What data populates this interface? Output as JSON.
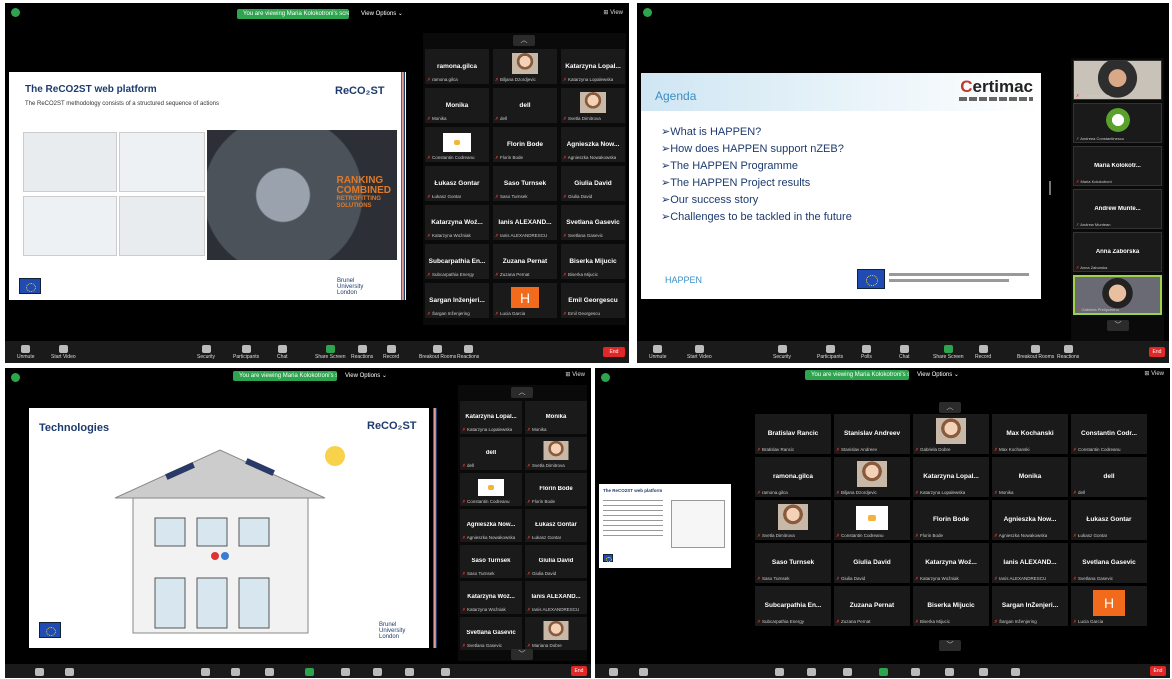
{
  "q1": {
    "banner": "You are viewing Maria Kolokotroni's screen",
    "view_options": "View Options ⌄",
    "view_corner": "⊞ View",
    "slide_title": "The ReCO2ST web platform",
    "slide_subtitle": "The ReCO2ST methodology consists of a structured sequence of actions",
    "slide_logo": "ReCO₂ST",
    "ranking": [
      "RANKING",
      "COMBINED",
      "RETROFITTING",
      "SOLUTIONS"
    ],
    "brunel": [
      "Brunel",
      "University",
      "London"
    ],
    "gallery": [
      {
        "name": "ramona.gilca",
        "label": "ramona.gilca",
        "type": "name"
      },
      {
        "name": "",
        "label": "Biljana Dzordjevic",
        "type": "pic"
      },
      {
        "name": "Katarzyna Lopal...",
        "label": "Katarzyna Lopalewska",
        "type": "name"
      },
      {
        "name": "Monika",
        "label": "Monika",
        "type": "name"
      },
      {
        "name": "dell",
        "label": "dell",
        "type": "name"
      },
      {
        "name": "",
        "label": "Svetla Dimitrova",
        "type": "pic"
      },
      {
        "name": "",
        "label": "Constantin Codreanu",
        "type": "wpic"
      },
      {
        "name": "Florin Bode",
        "label": "Florin Bode",
        "type": "name"
      },
      {
        "name": "Agnieszka Now...",
        "label": "Agnieszka Nowakowska",
        "type": "name"
      },
      {
        "name": "Łukasz Gontar",
        "label": "Łukasz Gontar",
        "type": "name"
      },
      {
        "name": "Saso Turnsek",
        "label": "Saso Turnsek",
        "type": "name"
      },
      {
        "name": "Giulia David",
        "label": "Giulia David",
        "type": "name"
      },
      {
        "name": "Katarzyna Woź...",
        "label": "Katarzyna Woźniak",
        "type": "name"
      },
      {
        "name": "Ianis ALEXAND...",
        "label": "Ianis ALEXANDRESCU",
        "type": "name"
      },
      {
        "name": "Svetlana Gasevic",
        "label": "Svetlana Gasevic",
        "type": "name"
      },
      {
        "name": "Subcarpathia En...",
        "label": "Subcarpathia Energy",
        "type": "name"
      },
      {
        "name": "Zuzana Pernat",
        "label": "Zuzana Pernat",
        "type": "name"
      },
      {
        "name": "Biserka Mijucic",
        "label": "Biserka Mijucic",
        "type": "name"
      },
      {
        "name": "Šargan Inženjeri...",
        "label": "Šargan Inženjering",
        "type": "name"
      },
      {
        "name": "H",
        "label": "Lucia Garcia",
        "type": "H"
      },
      {
        "name": "Emil Georgescu",
        "label": "Emil Georgescu",
        "type": "name"
      }
    ],
    "toolbar": [
      "Unmute",
      "Start Video",
      "Security",
      "Participants",
      "Chat",
      "Share Screen",
      "Reactions",
      "Record",
      "Breakout Rooms",
      "Reactions"
    ],
    "end": "End"
  },
  "q2": {
    "agenda_title": "Agenda",
    "brand": "ertimac",
    "brand_initial": "C",
    "bullets": [
      "➢What is HAPPEN?",
      "➢How does HAPPEN support nZEB?",
      "➢The HAPPEN Programme",
      "➢The HAPPEN Project results",
      "➢Our success story",
      "➢Challenges to be tackled in the future"
    ],
    "happen_logo": "HAPPEN",
    "side": [
      {
        "name": "",
        "label": "Dr. Ioannis Valta",
        "type": "cam"
      },
      {
        "name": "",
        "label": "Andreea Constantinescu",
        "type": "logo"
      },
      {
        "name": "Maria Kolokotr...",
        "label": "Maria Kolokotroni",
        "type": "name"
      },
      {
        "name": "Andrew Munte...",
        "label": "Andrew Muntean",
        "type": "name"
      },
      {
        "name": "Anna Zaborska",
        "label": "Anna Zaborska",
        "type": "name"
      },
      {
        "name": "",
        "label": "Gabriela Prelipceanu",
        "type": "cam2"
      }
    ],
    "toolbar": [
      "Unmute",
      "Start Video",
      "Security",
      "Participants",
      "Polls",
      "Chat",
      "Share Screen",
      "Record",
      "Breakout Rooms",
      "Reactions"
    ],
    "end": "End"
  },
  "q3": {
    "banner": "You are viewing Maria Kolokotroni's screen",
    "view_options": "View Options ⌄",
    "view_corner": "⊞ View",
    "slide_title": "Technologies",
    "slide_logo": "ReCO₂ST",
    "brunel": [
      "Brunel",
      "University",
      "London"
    ],
    "gallery": [
      {
        "name": "Katarzyna Lopal...",
        "label": "Katarzyna Lopalewska",
        "type": "name"
      },
      {
        "name": "Monika",
        "label": "Monika",
        "type": "name"
      },
      {
        "name": "dell",
        "label": "dell",
        "type": "name"
      },
      {
        "name": "",
        "label": "Svetla Dimitrova",
        "type": "pic"
      },
      {
        "name": "",
        "label": "Constantin Codreanu",
        "type": "wpic"
      },
      {
        "name": "Florin Bode",
        "label": "Florin Bode",
        "type": "name"
      },
      {
        "name": "Agnieszka Now...",
        "label": "Agnieszka Nowakowska",
        "type": "name"
      },
      {
        "name": "Łukasz Gontar",
        "label": "Łukasz Gontar",
        "type": "name"
      },
      {
        "name": "Saso Turnsek",
        "label": "Saso Turnsek",
        "type": "name"
      },
      {
        "name": "Giulia David",
        "label": "Giulia David",
        "type": "name"
      },
      {
        "name": "Katarzyna Woź...",
        "label": "Katarzyna Woźniak",
        "type": "name"
      },
      {
        "name": "Ianis ALEXAND...",
        "label": "Ianis ALEXANDRESCU",
        "type": "name"
      },
      {
        "name": "Svetlana Gasevic",
        "label": "Svetlana Gasevic",
        "type": "name"
      },
      {
        "name": "",
        "label": "Mariana Dobre",
        "type": "pic"
      }
    ],
    "end": "End"
  },
  "q4": {
    "banner": "You are viewing Maria Kolokotroni's screen",
    "view_options": "View Options ⌄",
    "view_corner": "⊞ View",
    "mini_title": "The ReCO2ST web platform",
    "grid": [
      {
        "name": "Bratislav Rancic",
        "label": "Bratislav Rancic",
        "type": "name"
      },
      {
        "name": "Stanislav Andreev",
        "label": "Stanislav Andreev",
        "type": "name"
      },
      {
        "name": "",
        "label": "Gabriela Dobre",
        "type": "pic"
      },
      {
        "name": "Max Kochanski",
        "label": "Max Kochanski",
        "type": "name"
      },
      {
        "name": "Constantin Codr...",
        "label": "Constantin Codreanu",
        "type": "name"
      },
      {
        "name": "ramona.gilca",
        "label": "ramona.gilca",
        "type": "name"
      },
      {
        "name": "",
        "label": "Biljana Dzordjevic",
        "type": "pic"
      },
      {
        "name": "Katarzyna Lopal...",
        "label": "Katarzyna Lopalewska",
        "type": "name"
      },
      {
        "name": "Monika",
        "label": "Monika",
        "type": "name"
      },
      {
        "name": "dell",
        "label": "dell",
        "type": "name"
      },
      {
        "name": "",
        "label": "Svetla Dimitrova",
        "type": "pic"
      },
      {
        "name": "",
        "label": "Constantin Codreanu",
        "type": "wpic"
      },
      {
        "name": "Florin Bode",
        "label": "Florin Bode",
        "type": "name"
      },
      {
        "name": "Agnieszka Now...",
        "label": "Agnieszka Nowakowska",
        "type": "name"
      },
      {
        "name": "Łukasz Gontar",
        "label": "Łukasz Gontar",
        "type": "name"
      },
      {
        "name": "Saso Turnsek",
        "label": "Saso Turnsek",
        "type": "name"
      },
      {
        "name": "Giulia David",
        "label": "Giulia David",
        "type": "name"
      },
      {
        "name": "Katarzyna Woź...",
        "label": "Katarzyna Woźniak",
        "type": "name"
      },
      {
        "name": "Ianis ALEXAND...",
        "label": "Ianis ALEXANDRESCU",
        "type": "name"
      },
      {
        "name": "Svetlana Gasevic",
        "label": "Svetlana Gasevic",
        "type": "name"
      },
      {
        "name": "Subcarpathia En...",
        "label": "Subcarpathia Energy",
        "type": "name"
      },
      {
        "name": "Zuzana Pernat",
        "label": "Zuzana Pernat",
        "type": "name"
      },
      {
        "name": "Biserka Mijucic",
        "label": "Biserka Mijucic",
        "type": "name"
      },
      {
        "name": "Šargan InŽenjeri...",
        "label": "Šargan Inženjering",
        "type": "name"
      },
      {
        "name": "H",
        "label": "Lucia Garcia",
        "type": "H"
      }
    ],
    "end": "End"
  }
}
